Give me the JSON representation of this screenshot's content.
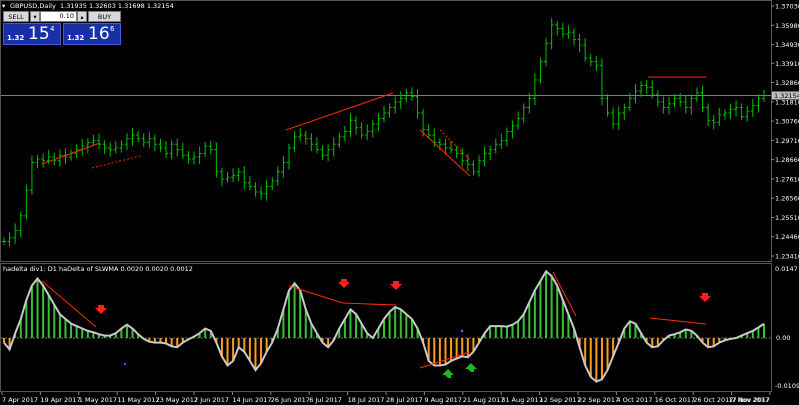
{
  "header": {
    "symbol": "GBPUSD,Daily",
    "ohlc": "1.31935 1.32603 1.31698 1.32154"
  },
  "trade_panel": {
    "sell_label": "SELL",
    "buy_label": "BUY",
    "lot": "0.10",
    "lot_down": "▾",
    "lot_up": "▴",
    "bid_small": "1.32",
    "bid_big": "15",
    "bid_sup": "4",
    "ask_small": "1.32",
    "ask_big": "16",
    "ask_sup": "6"
  },
  "price_axis": {
    "labels": [
      "1.37030",
      "1.35980",
      "1.34930",
      "1.33910",
      "1.32860",
      "1.31810",
      "1.30760",
      "1.29710",
      "1.28660",
      "1.27610",
      "1.26560",
      "1.25510",
      "1.24460",
      "1.23410"
    ],
    "current": "1.32154"
  },
  "indicator": {
    "title": "hadelta div1: D1 haDelta of SLWMA 0.0020 0.0020 0.0012",
    "scale_top": "0.0147",
    "scale_zero": "0.00",
    "scale_bottom": "-0.0109"
  },
  "time_axis": {
    "labels": [
      "7 Apr 2017",
      "19 Apr 2017",
      "1 May 2017",
      "11 May 2017",
      "23 May 2017",
      "2 Jun 2017",
      "14 Jun 2017",
      "26 Jun 2017",
      "6 Jul 2017",
      "18 Jul 2017",
      "28 Jul 2017",
      "9 Aug 2017",
      "21 Aug 2017",
      "31 Aug 2017",
      "12 Sep 2017",
      "22 Sep 2017",
      "4 Oct 2017",
      "16 Oct 2017",
      "26 Oct 2017",
      "7 Nov 2017",
      "17 Nov 2017"
    ]
  },
  "chart_data": {
    "type": "ohlc_bar",
    "symbol": "GBPUSD",
    "timeframe": "Daily",
    "closes": [
      1.242,
      1.244,
      1.248,
      1.256,
      1.27,
      1.285,
      1.287,
      1.286,
      1.288,
      1.286,
      1.289,
      1.288,
      1.29,
      1.292,
      1.294,
      1.296,
      1.297,
      1.295,
      1.293,
      1.292,
      1.293,
      1.295,
      1.298,
      1.3,
      1.298,
      1.296,
      1.298,
      1.295,
      1.293,
      1.29,
      1.295,
      1.292,
      1.289,
      1.287,
      1.288,
      1.29,
      1.294,
      1.292,
      1.28,
      1.276,
      1.277,
      1.278,
      1.28,
      1.274,
      1.272,
      1.269,
      1.268,
      1.272,
      1.275,
      1.28,
      1.285,
      1.293,
      1.299,
      1.3,
      1.298,
      1.295,
      1.292,
      1.289,
      1.292,
      1.295,
      1.299,
      1.302,
      1.308,
      1.304,
      1.3,
      1.302,
      1.306,
      1.309,
      1.312,
      1.315,
      1.318,
      1.32,
      1.323,
      1.321,
      1.312,
      1.303,
      1.3,
      1.296,
      1.295,
      1.293,
      1.292,
      1.29,
      1.286,
      1.284,
      1.28,
      1.286,
      1.29,
      1.292,
      1.295,
      1.297,
      1.302,
      1.305,
      1.309,
      1.315,
      1.32,
      1.33,
      1.34,
      1.35,
      1.36,
      1.358,
      1.355,
      1.356,
      1.352,
      1.349,
      1.342,
      1.34,
      1.338,
      1.32,
      1.312,
      1.306,
      1.312,
      1.315,
      1.32,
      1.324,
      1.327,
      1.326,
      1.322,
      1.318,
      1.315,
      1.317,
      1.32,
      1.318,
      1.315,
      1.32,
      1.323,
      1.315,
      1.308,
      1.307,
      1.311,
      1.312,
      1.314,
      1.315,
      1.31,
      1.313,
      1.316,
      1.32,
      1.3215
    ],
    "indicator_values": [
      -0.001,
      -0.0025,
      0.001,
      0.004,
      0.008,
      0.011,
      0.0125,
      0.011,
      0.009,
      0.007,
      0.005,
      0.004,
      0.003,
      0.0025,
      0.002,
      0.0015,
      0.0012,
      0.0008,
      0.0005,
      0.0005,
      0.001,
      0.002,
      0.0028,
      0.002,
      0.0008,
      -0.0002,
      -0.0008,
      -0.001,
      -0.001,
      -0.0012,
      -0.0018,
      -0.002,
      -0.001,
      -0.0003,
      0.0003,
      0.001,
      0.002,
      0.0015,
      -0.001,
      -0.004,
      -0.006,
      -0.005,
      -0.002,
      -0.003,
      -0.005,
      -0.007,
      -0.0055,
      -0.003,
      -0.001,
      0.002,
      0.006,
      0.01,
      0.0115,
      0.01,
      0.006,
      0.003,
      0.001,
      -0.001,
      -0.002,
      -0.0005,
      0.002,
      0.004,
      0.006,
      0.005,
      0.003,
      0.001,
      0.0,
      0.002,
      0.004,
      0.0055,
      0.0065,
      0.006,
      0.005,
      0.004,
      0.002,
      -0.001,
      -0.005,
      -0.006,
      -0.006,
      -0.0058,
      -0.005,
      -0.0045,
      -0.004,
      -0.0042,
      -0.003,
      -0.001,
      0.001,
      0.0025,
      0.0025,
      0.0025,
      0.0024,
      0.0028,
      0.0035,
      0.005,
      0.0075,
      0.01,
      0.012,
      0.014,
      0.013,
      0.011,
      0.008,
      0.005,
      0.002,
      -0.002,
      -0.006,
      -0.0085,
      -0.0095,
      -0.009,
      -0.007,
      -0.004,
      -0.001,
      0.002,
      0.0035,
      0.003,
      0.001,
      -0.001,
      -0.002,
      -0.0018,
      -0.0005,
      0.0005,
      0.0008,
      0.0012,
      0.0018,
      0.0015,
      0.0005,
      -0.001,
      -0.002,
      -0.0018,
      -0.001,
      -0.0005,
      -0.0002,
      0.0,
      0.0005,
      0.001,
      0.0015,
      0.0022,
      0.003
    ],
    "price_ylim": [
      1.2341,
      1.3703
    ],
    "indicator_ylim": [
      -0.0109,
      0.0147
    ],
    "current_price": 1.32154,
    "colors": {
      "up_bar": "#00c000",
      "down_bar": "#00c000",
      "ind_pos": "#36c236",
      "ind_neg": "#ff9c1a",
      "ind_line": "#c0c0c0",
      "divergence": "#ff2a00",
      "arrow_down": "#ff2020",
      "arrow_up": "#1fb81f",
      "grid": "#404040"
    }
  }
}
